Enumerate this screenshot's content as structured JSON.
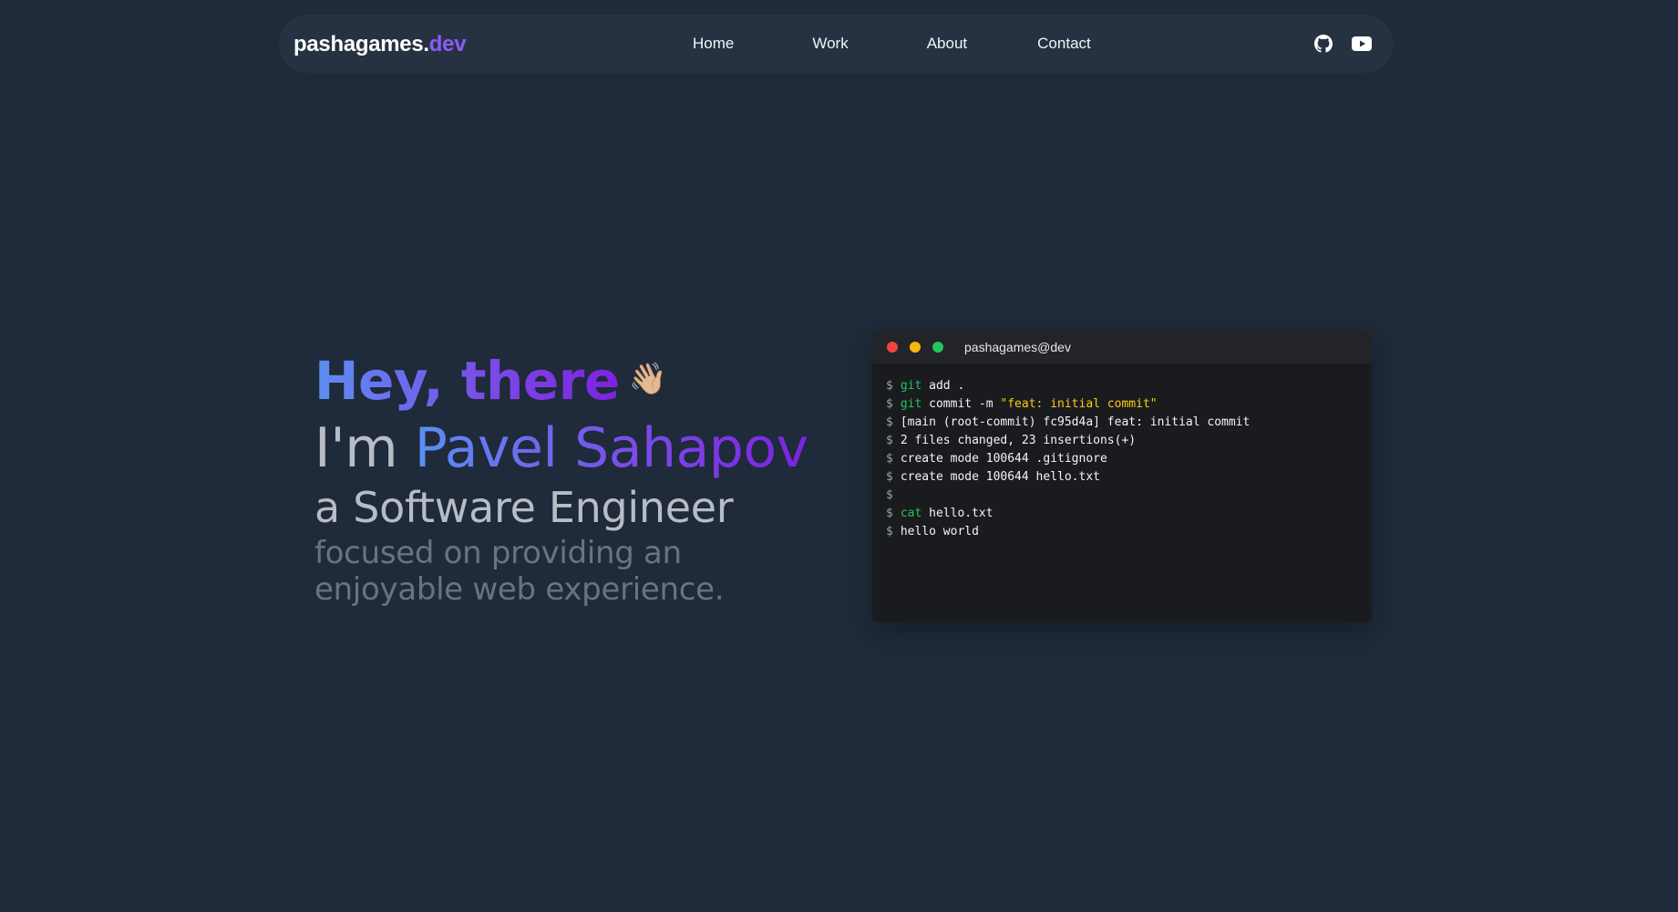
{
  "nav": {
    "logo_main": "pashagames.",
    "logo_accent": "dev",
    "links": [
      "Home",
      "Work",
      "About",
      "Contact"
    ],
    "icons": [
      "github-icon",
      "youtube-icon"
    ]
  },
  "hero": {
    "greeting": "Hey, there",
    "wave_emoji": "👋🏼",
    "im_prefix": "I'm ",
    "name": "Pavel Sahapov",
    "role": "a Software Engineer",
    "tagline": "focused on providing an enjoyable web experience."
  },
  "terminal": {
    "title": "pashagames@dev",
    "prompt": "$",
    "lines": [
      {
        "cmd": "git",
        "text": " add ."
      },
      {
        "cmd": "git",
        "text": " commit -m ",
        "str": "\"feat: initial commit\""
      },
      {
        "cmd": "",
        "text": "[main (root-commit) fc95d4a] feat: initial commit"
      },
      {
        "cmd": "",
        "text": "2 files changed, 23 insertions(+)"
      },
      {
        "cmd": "",
        "text": "create mode 100644 .gitignore"
      },
      {
        "cmd": "",
        "text": "create mode 100644 hello.txt"
      },
      {
        "cmd": "",
        "text": ""
      },
      {
        "cmd": "cat",
        "text": " hello.txt"
      },
      {
        "cmd": "",
        "text": "hello world"
      }
    ]
  },
  "colors": {
    "background": "#1f2a3a",
    "navbar": "#263241",
    "accent": "#8b5cf6",
    "terminal_bg": "#1a1b1e",
    "command_green": "#22c55e",
    "string_yellow": "#facc15"
  }
}
